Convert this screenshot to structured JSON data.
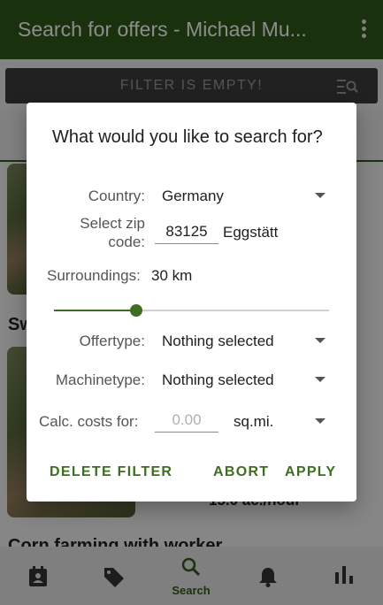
{
  "app_bar": {
    "title": "Search for offers - Michael Mu..."
  },
  "filter_bar": {
    "label": "FILTER IS EMPTY!"
  },
  "background": {
    "item_title_1": "Sw",
    "item_title_2": "Corn farming with worker",
    "item_rate": "15.0 ac./hour"
  },
  "bottom_nav": {
    "items": [
      {
        "icon": "calendar-person-icon"
      },
      {
        "icon": "tag-icon"
      },
      {
        "icon": "search-icon",
        "label": "Search"
      },
      {
        "icon": "bell-icon"
      },
      {
        "icon": "bar-chart-icon"
      }
    ]
  },
  "dialog": {
    "title": "What would you like to search for?",
    "country_label": "Country:",
    "country_value": "Germany",
    "zip_label_line1": "Select zip",
    "zip_label_line2": "code:",
    "zip_value": "83125",
    "zip_city": "Eggstätt",
    "surroundings_label": "Surroundings:",
    "surroundings_value": "30 km",
    "surroundings_fraction": 0.3,
    "offertype_label": "Offertype:",
    "offertype_value": "Nothing selected",
    "machinetype_label": "Machinetype:",
    "machinetype_value": "Nothing selected",
    "calc_label": "Calc. costs for:",
    "calc_placeholder": "0.00",
    "calc_unit": "sq.mi.",
    "delete_label": "DELETE FILTER",
    "abort_label": "ABORT",
    "apply_label": "APPLY"
  },
  "colors": {
    "app_bar": "#2f5a19",
    "accent": "#3d6e21"
  }
}
